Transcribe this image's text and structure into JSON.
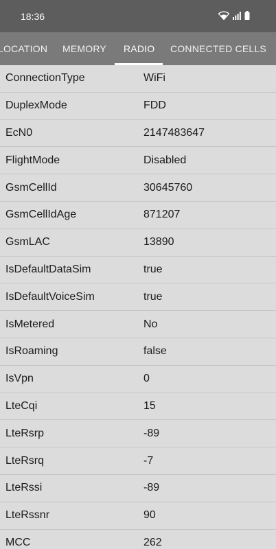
{
  "status_bar": {
    "time": "18:36",
    "icons": [
      "wifi-icon",
      "signal-icon",
      "battery-icon"
    ],
    "bg_color": "#5d5d5d"
  },
  "tabs": [
    {
      "label": "LOCATION",
      "active": false
    },
    {
      "label": "MEMORY",
      "active": false
    },
    {
      "label": "RADIO",
      "active": true
    },
    {
      "label": "CONNECTED CELLS",
      "active": false
    }
  ],
  "rows": [
    {
      "key": "ConnectionType",
      "value": "WiFi"
    },
    {
      "key": "DuplexMode",
      "value": "FDD"
    },
    {
      "key": "EcN0",
      "value": "2147483647"
    },
    {
      "key": "FlightMode",
      "value": "Disabled"
    },
    {
      "key": "GsmCellId",
      "value": "30645760"
    },
    {
      "key": "GsmCellIdAge",
      "value": "871207"
    },
    {
      "key": "GsmLAC",
      "value": "13890"
    },
    {
      "key": "IsDefaultDataSim",
      "value": "true"
    },
    {
      "key": "IsDefaultVoiceSim",
      "value": "true"
    },
    {
      "key": "IsMetered",
      "value": "No"
    },
    {
      "key": "IsRoaming",
      "value": "false"
    },
    {
      "key": "IsVpn",
      "value": "0"
    },
    {
      "key": "LteCqi",
      "value": "15"
    },
    {
      "key": "LteRsrp",
      "value": "-89"
    },
    {
      "key": "LteRsrq",
      "value": "-7"
    },
    {
      "key": "LteRssi",
      "value": "-89"
    },
    {
      "key": "LteRssnr",
      "value": "90"
    },
    {
      "key": "MCC",
      "value": "262"
    }
  ]
}
